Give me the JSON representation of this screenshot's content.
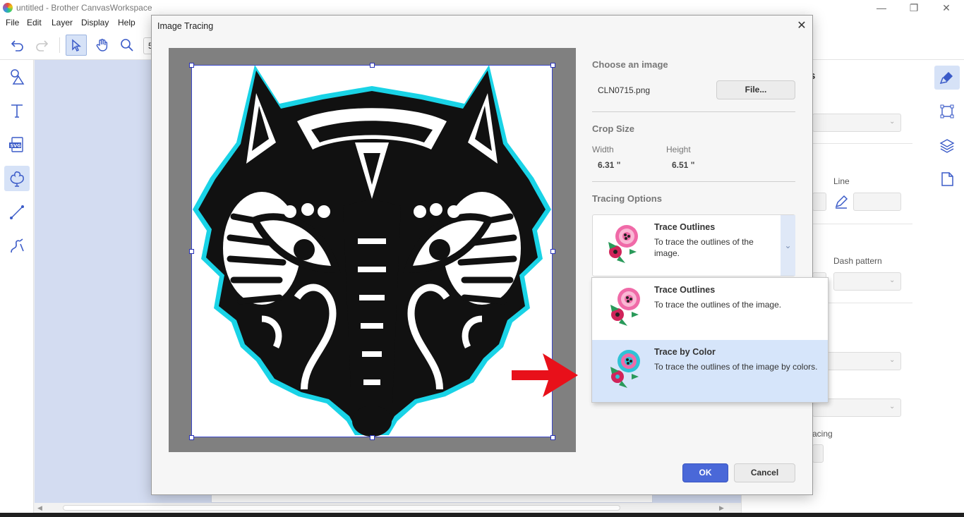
{
  "app": {
    "window_title": "untitled - Brother CanvasWorkspace",
    "menu": [
      "File",
      "Edit",
      "Layer",
      "Display",
      "Help"
    ],
    "toolbar_partial_value": "5"
  },
  "right_panel": {
    "line_label": "Line",
    "dash_pattern_label": "Dash pattern",
    "spacing_fragment": "acing",
    "header_fragment": "s"
  },
  "dialog": {
    "title": "Image Tracing",
    "choose_image": {
      "heading": "Choose an image",
      "filename": "CLN0715.png",
      "file_button": "File..."
    },
    "crop_size": {
      "heading": "Crop Size",
      "width_label": "Width",
      "width_value": "6.31 \"",
      "height_label": "Height",
      "height_value": "6.51 \""
    },
    "tracing_options": {
      "heading": "Tracing Options",
      "selected": {
        "title": "Trace Outlines",
        "desc": "To trace the outlines of the image."
      },
      "options": [
        {
          "title": "Trace Outlines",
          "desc": "To trace the outlines of the image."
        },
        {
          "title": "Trace by Color",
          "desc": "To trace the outlines of the image by colors."
        }
      ]
    },
    "ok_button": "OK",
    "cancel_button": "Cancel"
  },
  "colors": {
    "accent": "#4a68d8",
    "highlight": "#d6e5fa",
    "canvas_bg": "#d3dcf1",
    "arrow": "#e8101a",
    "trace_outline": "#19d3e6"
  },
  "icons": [
    "minimize-icon",
    "restore-icon",
    "close-icon",
    "undo-icon",
    "redo-icon",
    "select-icon",
    "hand-icon",
    "zoom-icon",
    "shapes-icon",
    "text-icon",
    "svg-icon",
    "image-trace-icon",
    "line-icon",
    "pen-icon",
    "brush-icon",
    "transform-icon",
    "layers-icon",
    "page-icon",
    "chevron-down-icon",
    "flower-icon",
    "red-arrow-icon"
  ]
}
